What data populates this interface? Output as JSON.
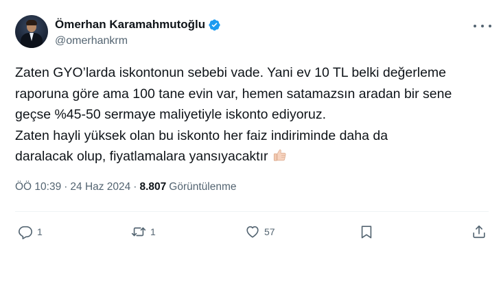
{
  "author": {
    "display_name": "Ömerhan Karamahmutoğlu",
    "handle": "@omerhankrm",
    "verified": true
  },
  "tweet": {
    "lines": [
      "Zaten GYO’larda iskontonun sebebi vade. Yani ev 10 TL belki değerleme",
      "raporuna göre ama 100 tane evin var, hemen satamazsın aradan bir sene",
      "geçse %45-50 sermaye maliyetiyle iskonto ediyoruz.",
      "Zaten hayli yüksek olan bu iskonto her faiz indiriminde daha da",
      "daralacak olup, fiyatlamalara yansıyacaktır"
    ],
    "emoji": "thumbs-up"
  },
  "meta": {
    "time": "ÖÖ 10:39",
    "separator": "·",
    "date": "24 Haz 2024",
    "views_count": "8.807",
    "views_label": "Görüntülenme"
  },
  "actions": {
    "reply_count": "1",
    "retweet_count": "1",
    "like_count": "57"
  },
  "icons": {
    "verified": "verified-badge-icon",
    "more": "more-icon",
    "reply": "reply-icon",
    "retweet": "retweet-icon",
    "like": "heart-icon",
    "bookmark": "bookmark-icon",
    "share": "share-icon"
  },
  "colors": {
    "text": "#0f1419",
    "secondary": "#536471",
    "verified": "#1d9bf0",
    "divider": "#eff3f4"
  }
}
